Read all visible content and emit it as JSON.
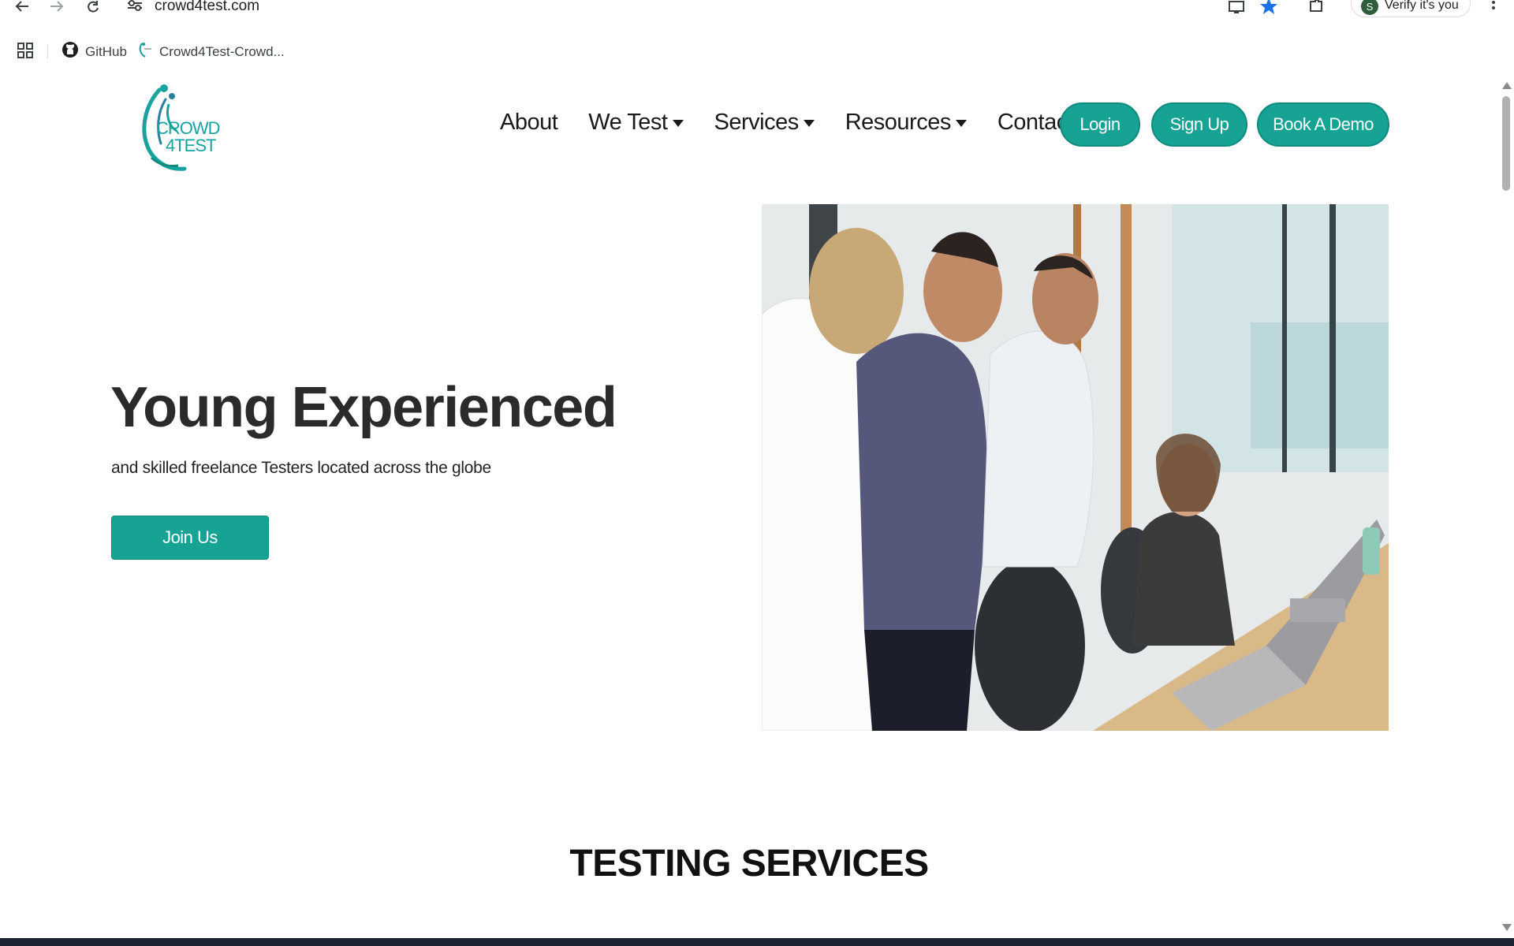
{
  "browser": {
    "url": "crowd4test.com",
    "profile_label": "Verify it's you",
    "profile_initial": "S",
    "bookmarks": [
      {
        "label": "GitHub",
        "icon": "github-icon"
      },
      {
        "label": "Crowd4Test-Crowd...",
        "icon": "crowd4test-favicon"
      }
    ]
  },
  "site": {
    "logo_line1": "CROWD",
    "logo_line2": "4TEST",
    "nav": {
      "about": "About",
      "we_test": "We Test",
      "services": "Services",
      "resources": "Resources",
      "contact": "Contact"
    },
    "buttons": {
      "login": "Login",
      "signup": "Sign Up",
      "demo": "Book A Demo"
    },
    "hero": {
      "title": "Young Experienced",
      "subtitle": "and skilled freelance Testers located across the globe",
      "cta": "Join Us"
    },
    "section_title": "TESTING SERVICES"
  },
  "colors": {
    "brand_teal": "#16a394",
    "logo_teal": "#17a3a0",
    "text_dark": "#2b2b2b"
  }
}
